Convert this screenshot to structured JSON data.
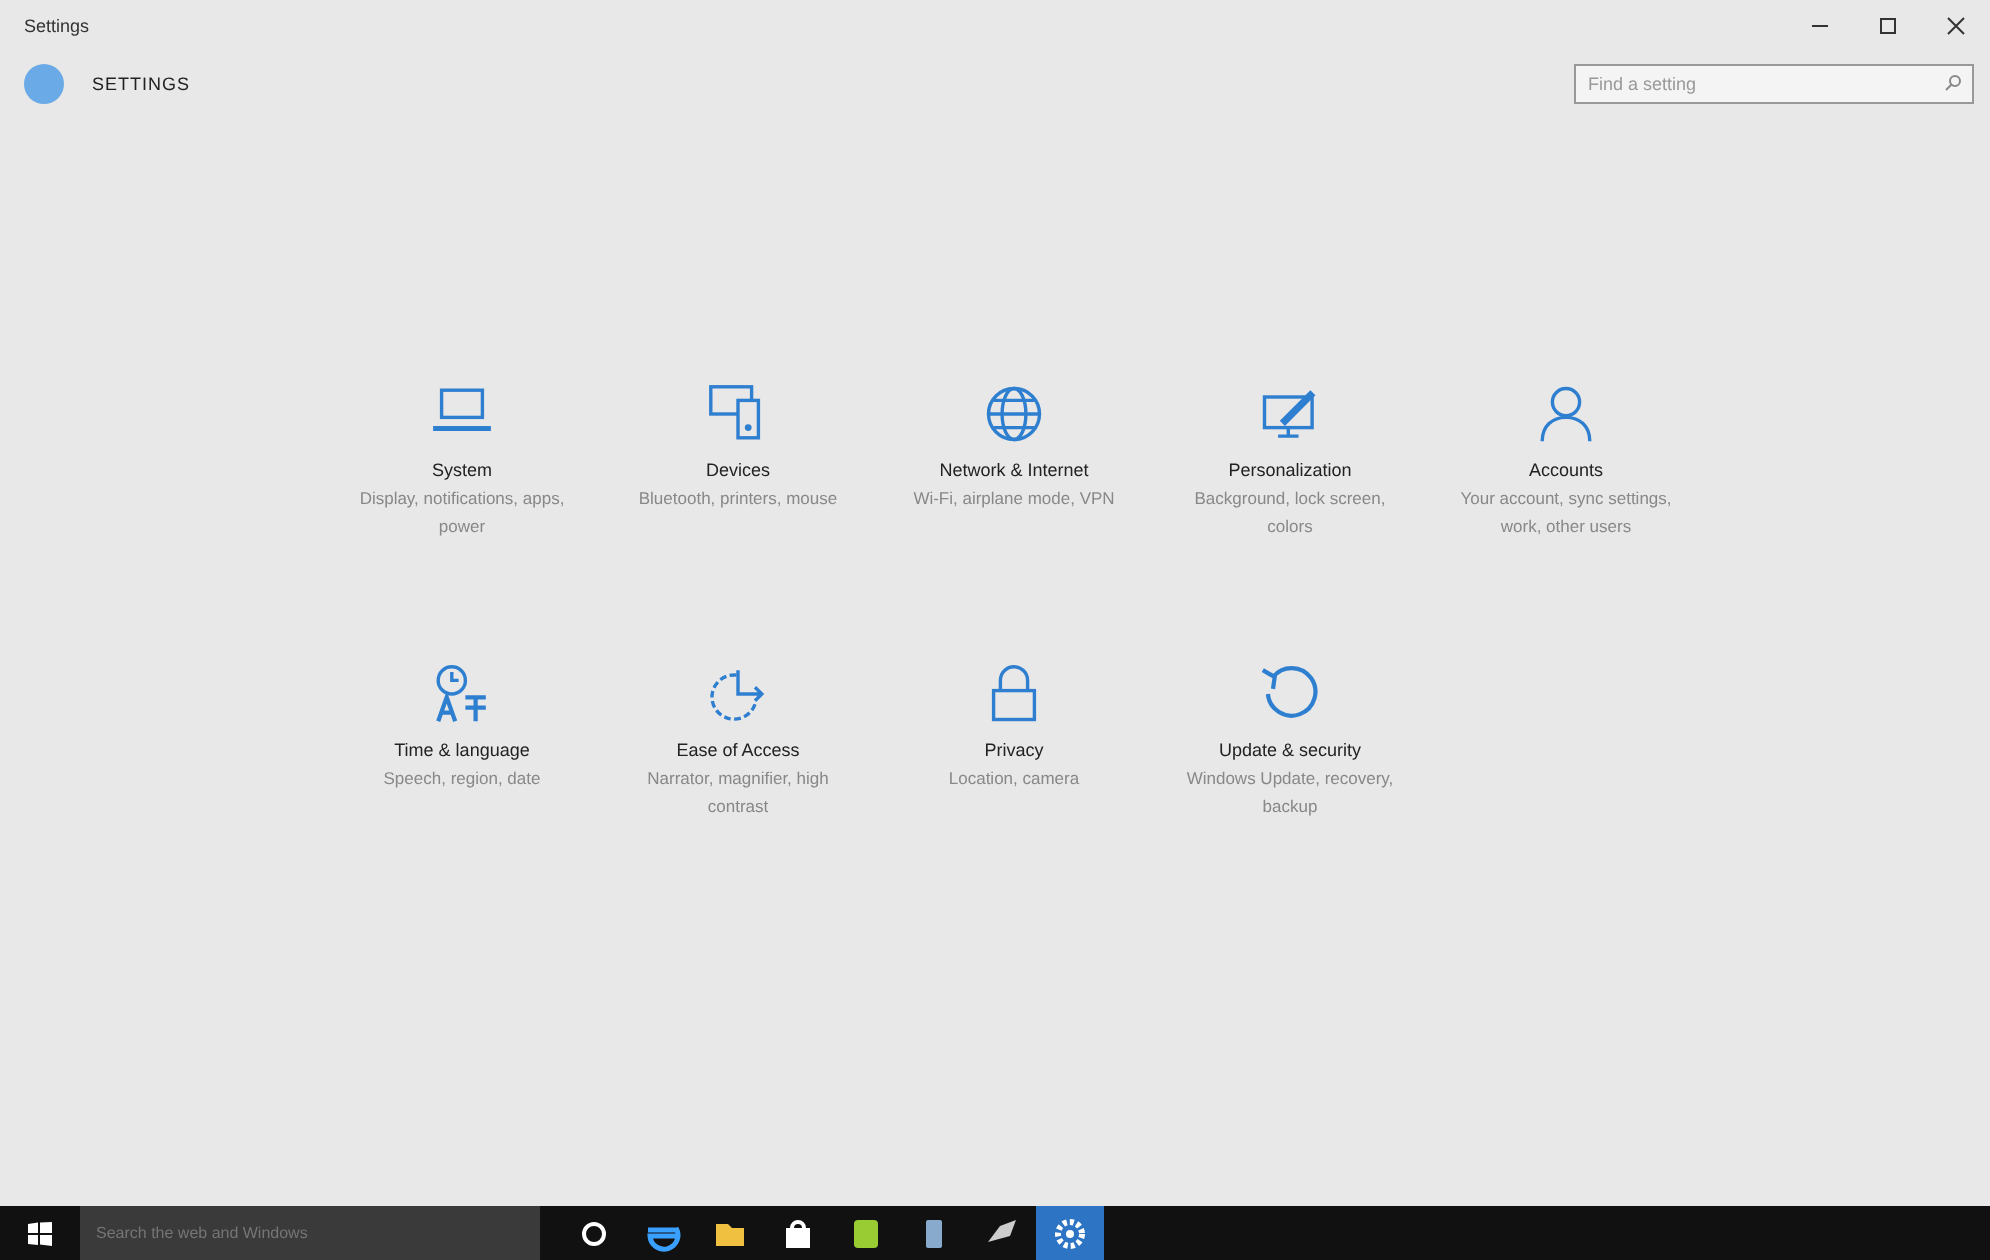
{
  "window": {
    "title": "Settings",
    "heading": "SETTINGS"
  },
  "search": {
    "placeholder": "Find a setting"
  },
  "categories": [
    {
      "title": "System",
      "description": "Display, notifications, apps, power"
    },
    {
      "title": "Devices",
      "description": "Bluetooth, printers, mouse"
    },
    {
      "title": "Network & Internet",
      "description": "Wi-Fi, airplane mode, VPN"
    },
    {
      "title": "Personalization",
      "description": "Background, lock screen, colors"
    },
    {
      "title": "Accounts",
      "description": "Your account, sync settings, work, other users"
    },
    {
      "title": "Time & language",
      "description": "Speech, region, date"
    },
    {
      "title": "Ease of Access",
      "description": "Narrator, magnifier, high contrast"
    },
    {
      "title": "Privacy",
      "description": "Location, camera"
    },
    {
      "title": "Update & security",
      "description": "Windows Update, recovery, backup"
    }
  ],
  "taskbar": {
    "search_placeholder": "Search the web and Windows",
    "apps": [
      {
        "selected": false
      },
      {
        "selected": false
      },
      {
        "selected": false
      },
      {
        "selected": false
      },
      {
        "selected": false
      },
      {
        "selected": false
      },
      {
        "selected": false
      },
      {
        "selected": true
      }
    ]
  }
}
